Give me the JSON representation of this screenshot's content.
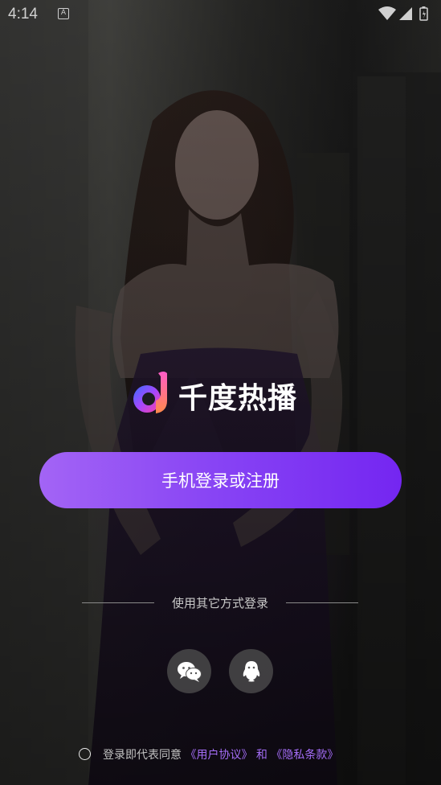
{
  "status_bar": {
    "time": "4:14",
    "notification_icon": "A"
  },
  "app": {
    "name": "千度热播",
    "logo_icon": "music-note-d-icon"
  },
  "primary_login": {
    "label": "手机登录或注册"
  },
  "other_login": {
    "label": "使用其它方式登录",
    "methods": [
      {
        "name": "wechat",
        "icon": "wechat-icon"
      },
      {
        "name": "qq",
        "icon": "qq-icon"
      }
    ]
  },
  "agreement": {
    "prefix": "登录即代表同意",
    "user_agreement": "《用户协议》",
    "connector": "和",
    "privacy_policy": "《隐私条款》"
  },
  "colors": {
    "accent_start": "#a364f5",
    "accent_end": "#7426f1",
    "link": "#a46df7"
  }
}
